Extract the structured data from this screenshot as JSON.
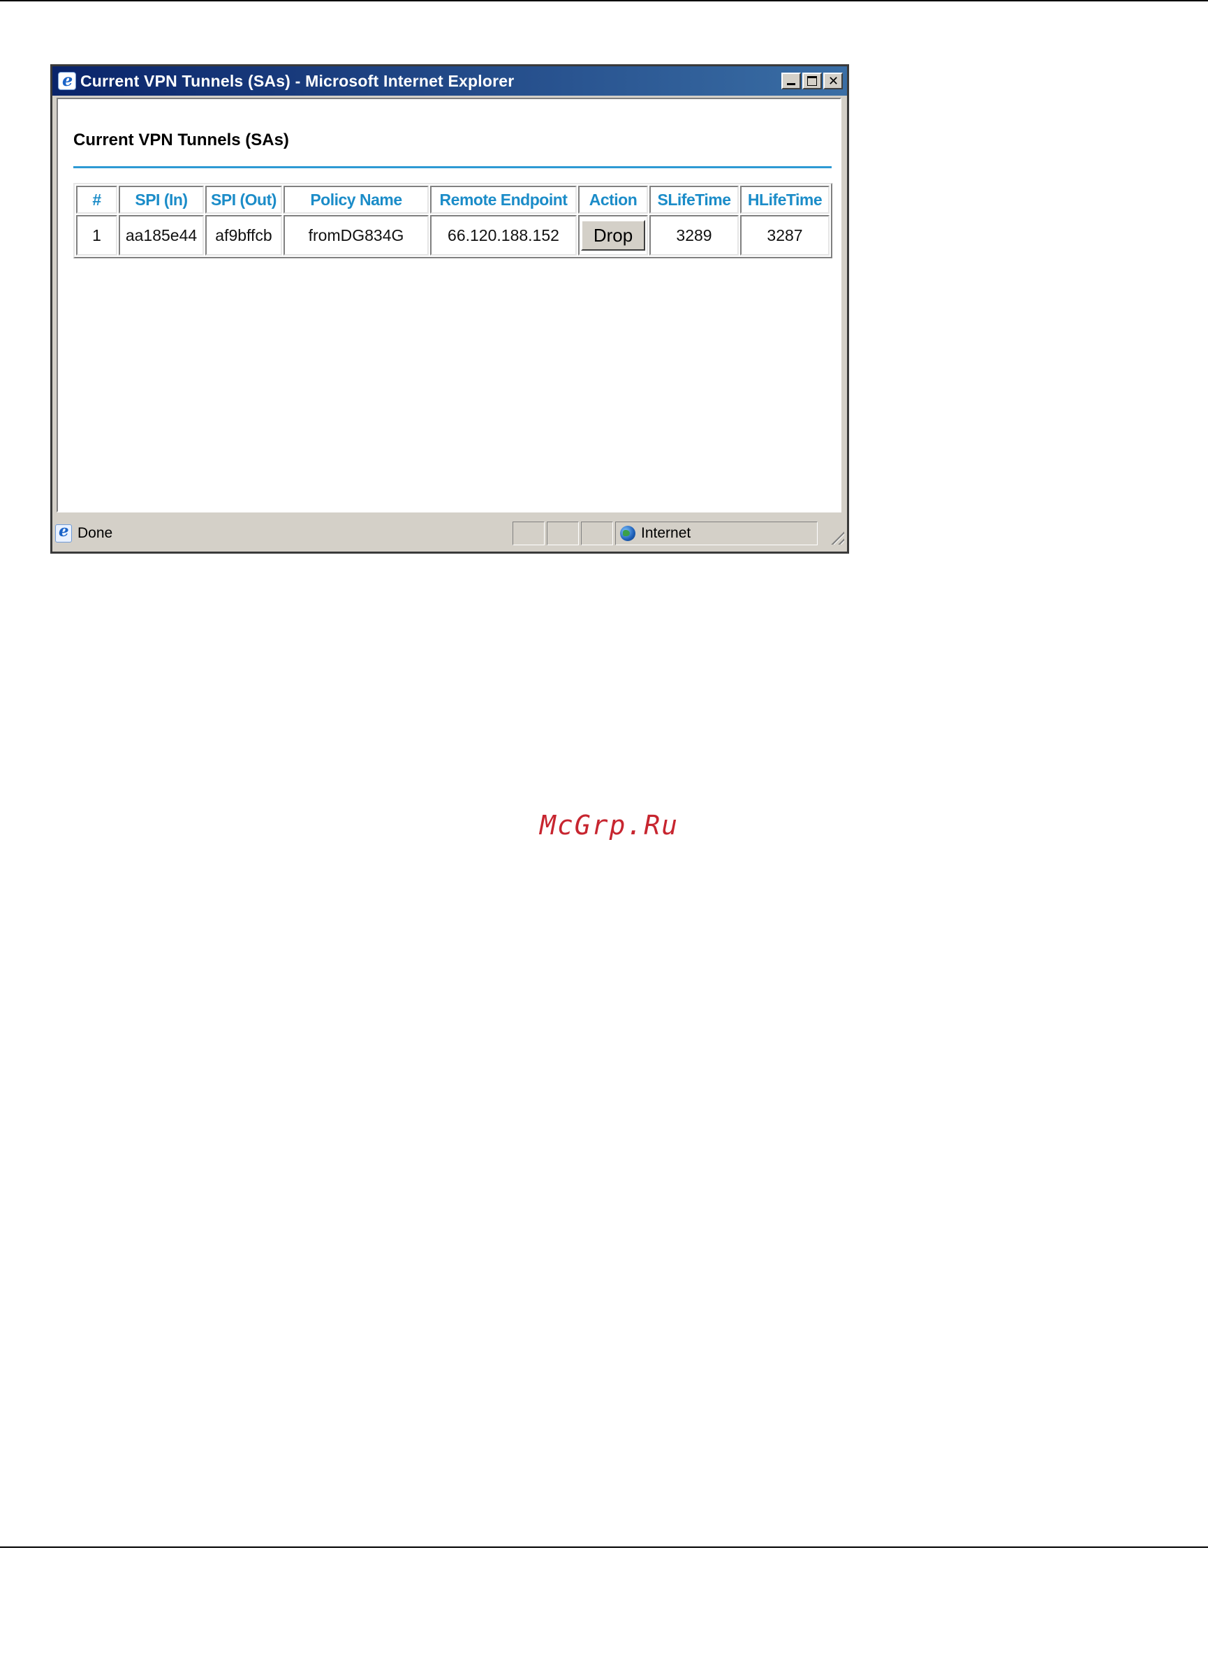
{
  "window": {
    "title": "Current VPN Tunnels (SAs) - Microsoft Internet Explorer"
  },
  "page": {
    "heading": "Current VPN Tunnels (SAs)"
  },
  "table": {
    "headers": [
      "#",
      "SPI (In)",
      "SPI (Out)",
      "Policy Name",
      "Remote Endpoint",
      "Action",
      "SLifeTime",
      "HLifeTime"
    ],
    "rows": [
      {
        "num": "1",
        "spi_in": "aa185e44",
        "spi_out": "af9bffcb",
        "policy_name": "fromDG834G",
        "remote_endpoint": "66.120.188.152",
        "action_label": "Drop",
        "slifetime": "3289",
        "hlifetime": "3287"
      }
    ]
  },
  "statusbar": {
    "status": "Done",
    "zone": "Internet"
  },
  "watermark": "McGrp.Ru",
  "colors": {
    "title_bar": "#0a246a",
    "accent": "#2e9ad4",
    "header_text": "#1b8cc8",
    "watermark": "#c7252f"
  }
}
